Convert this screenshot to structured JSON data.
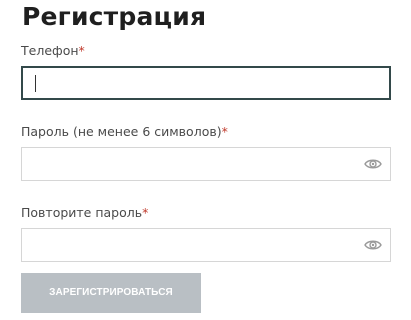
{
  "form": {
    "title": "Регистрация",
    "required_mark": "*",
    "phone": {
      "label": "Телефон",
      "value": ""
    },
    "password": {
      "label": "Пароль (не менее 6 символов)",
      "value": "",
      "toggle_icon": "eye-icon"
    },
    "password_repeat": {
      "label": "Повторите пароль",
      "value": "",
      "toggle_icon": "eye-icon"
    },
    "submit_label": "ЗАРЕГИСТРИРОВАТЬСЯ",
    "colors": {
      "title": "#1f1f1f",
      "required": "#c0392b",
      "active_border": "#33494a",
      "button_bg": "#b9bfc4"
    }
  }
}
